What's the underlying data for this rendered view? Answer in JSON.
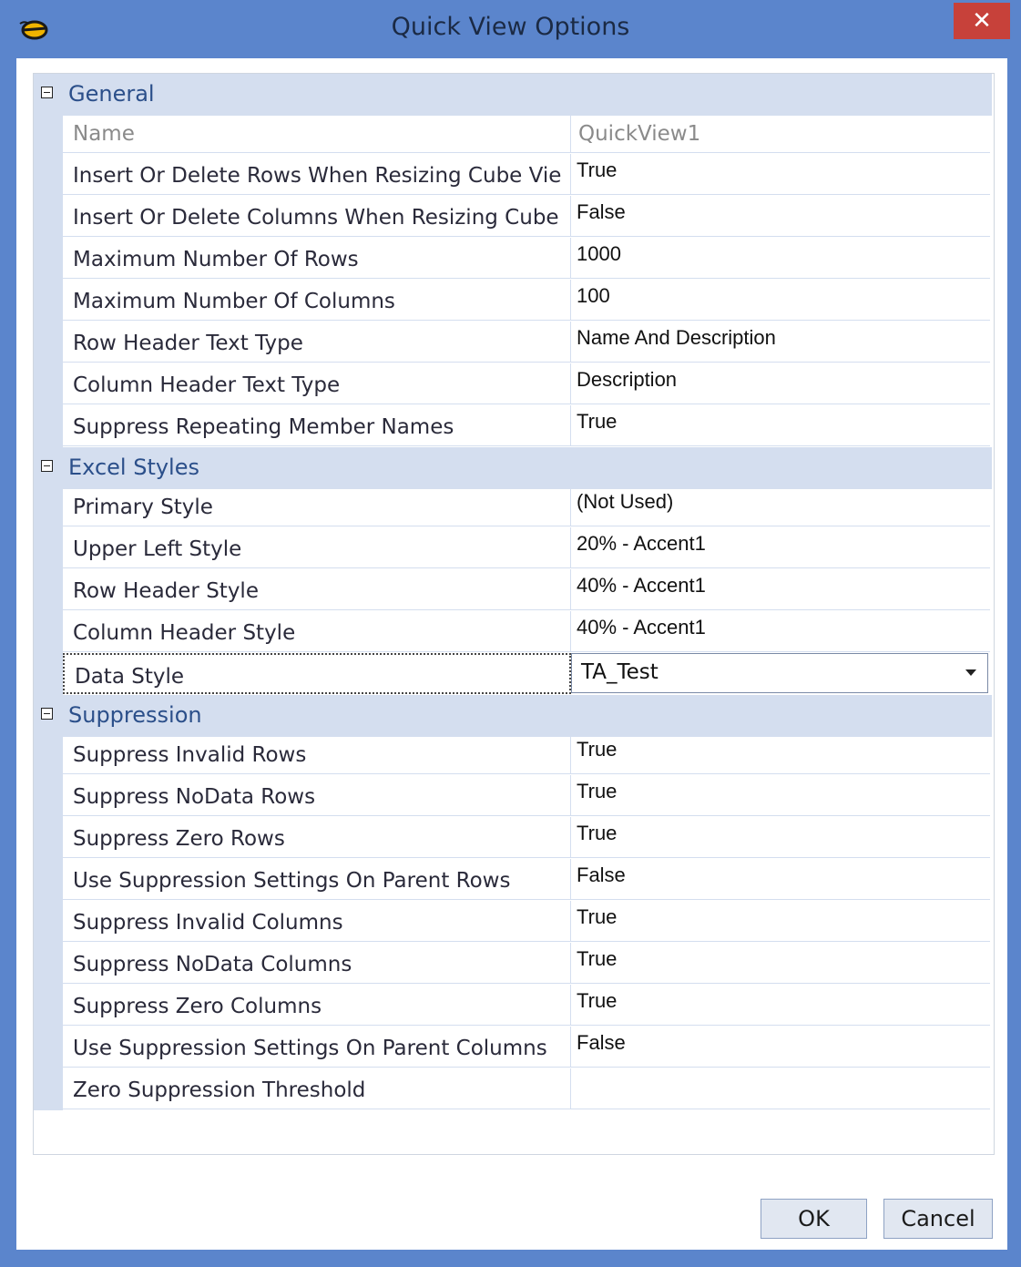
{
  "window": {
    "title": "Quick View Options",
    "close_label": "✕"
  },
  "categories": {
    "general": "General",
    "excel_styles": "Excel Styles",
    "suppression": "Suppression"
  },
  "general": [
    {
      "name": "Name",
      "value": "QuickView1"
    },
    {
      "name": "Insert Or Delete Rows When Resizing Cube Vie",
      "value": "True"
    },
    {
      "name": "Insert Or Delete Columns When Resizing Cube",
      "value": "False"
    },
    {
      "name": "Maximum Number Of Rows",
      "value": "1000"
    },
    {
      "name": "Maximum Number Of Columns",
      "value": "100"
    },
    {
      "name": "Row Header Text Type",
      "value": "Name And Description"
    },
    {
      "name": "Column Header Text Type",
      "value": "Description"
    },
    {
      "name": "Suppress Repeating Member Names",
      "value": "True"
    }
  ],
  "excel_styles": [
    {
      "name": "Primary Style",
      "value": "(Not Used)"
    },
    {
      "name": "Upper Left Style",
      "value": "20% - Accent1"
    },
    {
      "name": "Row Header Style",
      "value": "40% - Accent1"
    },
    {
      "name": "Column Header Style",
      "value": "40% - Accent1"
    },
    {
      "name": "Data Style",
      "value": "TA_Test"
    }
  ],
  "suppression": [
    {
      "name": "Suppress Invalid Rows",
      "value": "True"
    },
    {
      "name": "Suppress NoData Rows",
      "value": "True"
    },
    {
      "name": "Suppress Zero Rows",
      "value": "True"
    },
    {
      "name": "Use Suppression Settings On Parent Rows",
      "value": "False"
    },
    {
      "name": "Suppress Invalid Columns",
      "value": "True"
    },
    {
      "name": "Suppress NoData Columns",
      "value": "True"
    },
    {
      "name": "Suppress Zero Columns",
      "value": "True"
    },
    {
      "name": "Use Suppression Settings On Parent Columns",
      "value": "False"
    },
    {
      "name": "Zero Suppression Threshold",
      "value": ""
    }
  ],
  "buttons": {
    "ok": "OK",
    "cancel": "Cancel"
  },
  "colors": {
    "title_bar": "#5b85cc",
    "category_band": "#d4deef",
    "close_button": "#c7413a"
  }
}
